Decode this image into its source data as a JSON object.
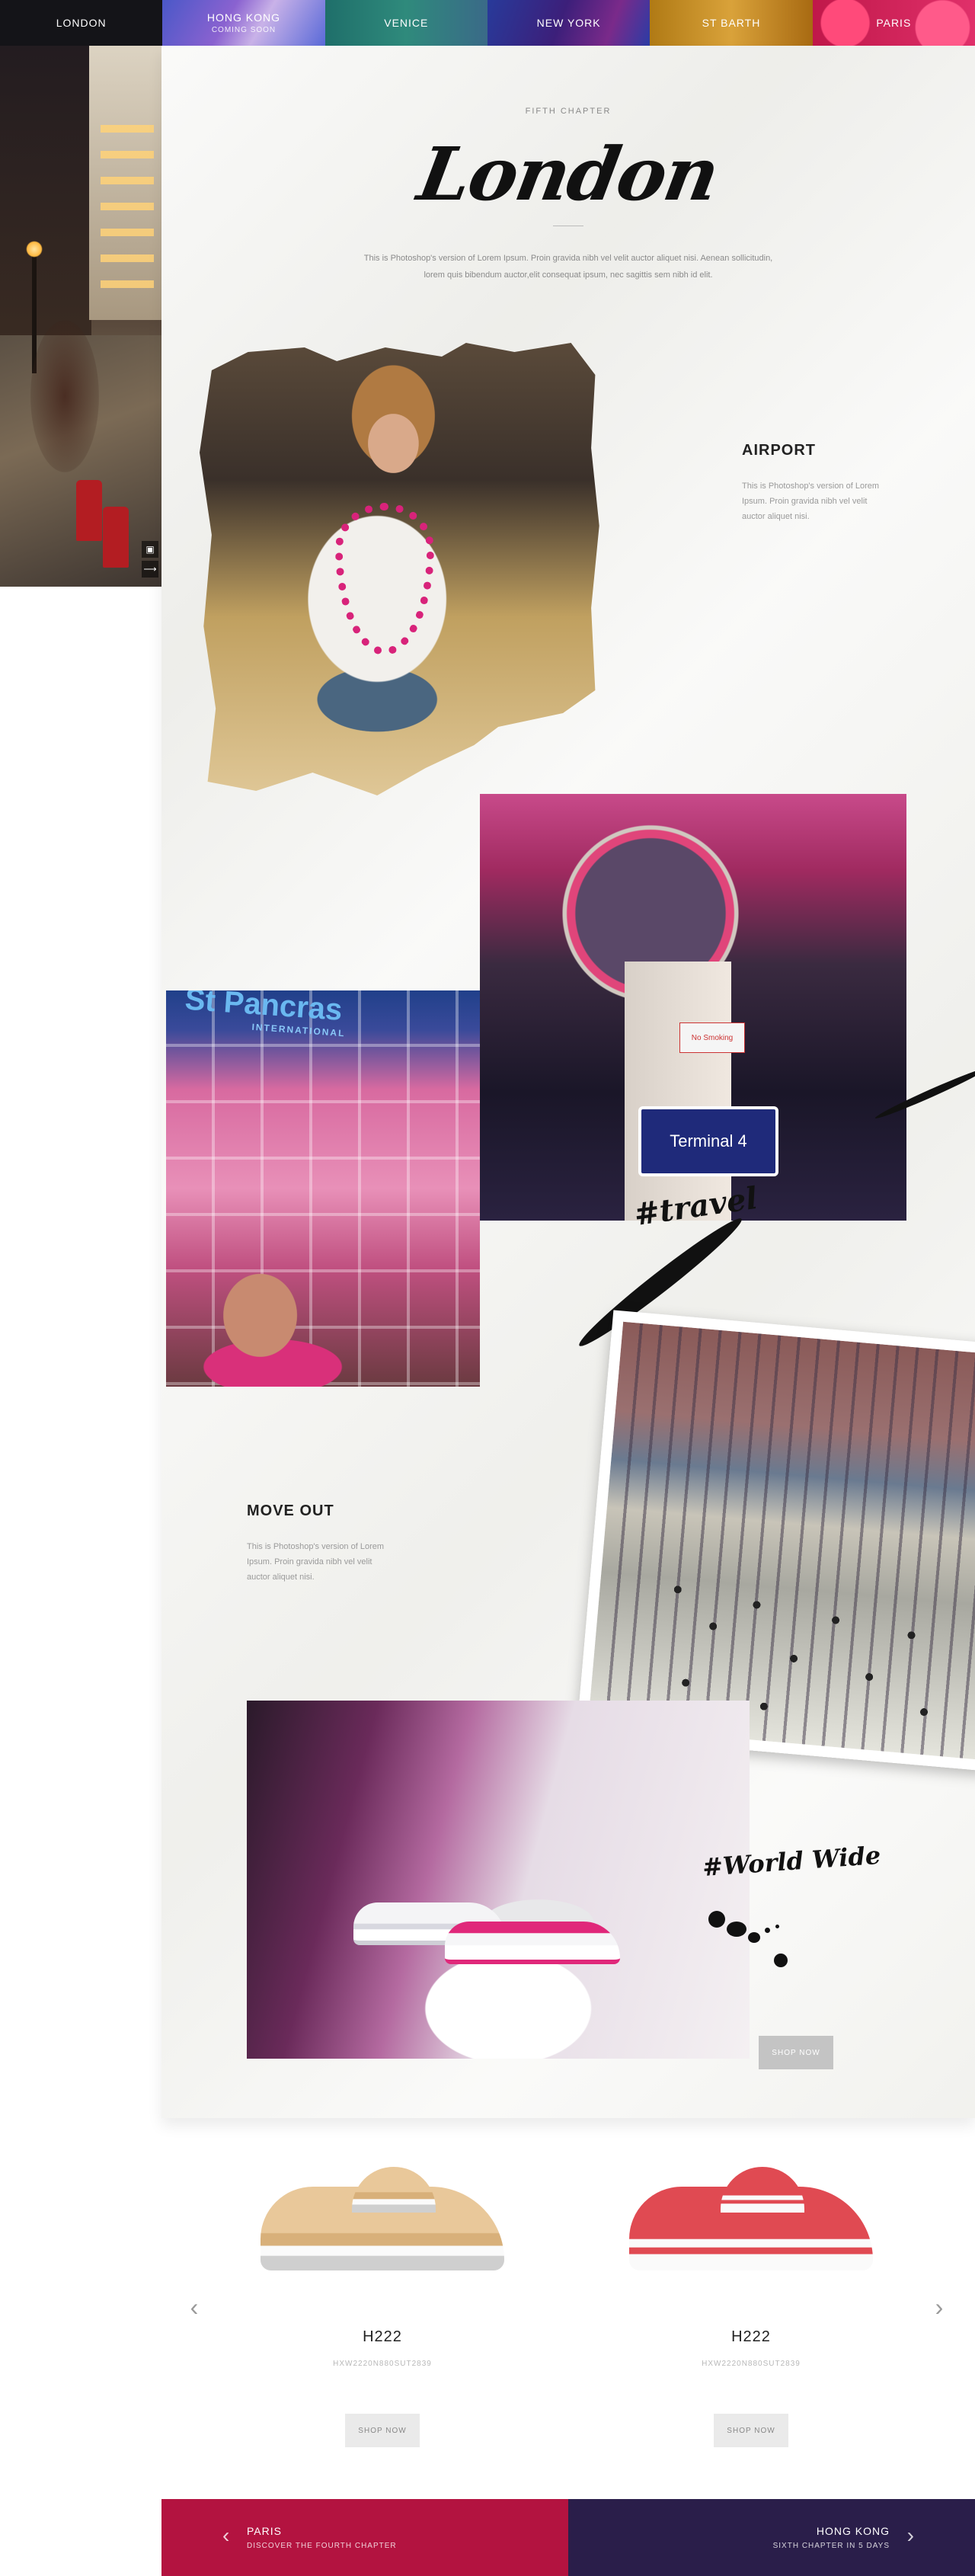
{
  "nav": {
    "tabs": [
      {
        "label": "LONDON",
        "sub": ""
      },
      {
        "label": "HONG KONG",
        "sub": "COMING SOON"
      },
      {
        "label": "VENICE",
        "sub": ""
      },
      {
        "label": "NEW YORK",
        "sub": ""
      },
      {
        "label": "ST BARTH",
        "sub": ""
      },
      {
        "label": "PARIS",
        "sub": ""
      }
    ]
  },
  "article": {
    "chapter_label": "FIFTH CHAPTER",
    "title": "London",
    "intro": "This is Photoshop's version  of Lorem Ipsum. Proin gravida nibh vel velit auctor aliquet nisi. Aenean sollicitudin, lorem quis bibendum auctor,elit consequat ipsum, nec sagittis sem nibh id elit.",
    "sections": [
      {
        "title": "AIRPORT",
        "body": "This is Photoshop's version  of Lorem Ipsum. Proin gravida nibh vel velit auctor aliquet nisi."
      },
      {
        "title": "MOVE OUT",
        "body": "This is Photoshop's version  of Lorem Ipsum. Proin gravida nibh vel velit auctor aliquet nisi."
      }
    ],
    "photo_text": {
      "mirror_sign": "Terminal 4",
      "no_smoking": "No Smoking",
      "station_sign": "St Pancras",
      "station_sub": "INTERNATIONAL"
    },
    "hashtags": {
      "travel": "#travel",
      "worldwide": "#World Wide"
    },
    "shop_now": "SHOP NOW"
  },
  "products": [
    {
      "name": "H222",
      "code": "HXW2220N880SUT2839",
      "shop": "SHOP NOW",
      "color": "#e9c89a"
    },
    {
      "name": "H222",
      "code": "HXW2220N880SUT2839",
      "shop": "SHOP NOW",
      "color": "#e04a52"
    }
  ],
  "chapter_nav": {
    "prev": {
      "city": "PARIS",
      "desc": "DISCOVER THE FOURTH CHAPTER",
      "color": "#b31340"
    },
    "next": {
      "city": "HONG KONG",
      "desc": "SIXTH CHAPTER IN 5 DAYS",
      "color": "#2a1e4a"
    }
  },
  "icons": [
    "instagram-icon",
    "share-icon",
    "chevron-left-icon",
    "chevron-right-icon"
  ]
}
